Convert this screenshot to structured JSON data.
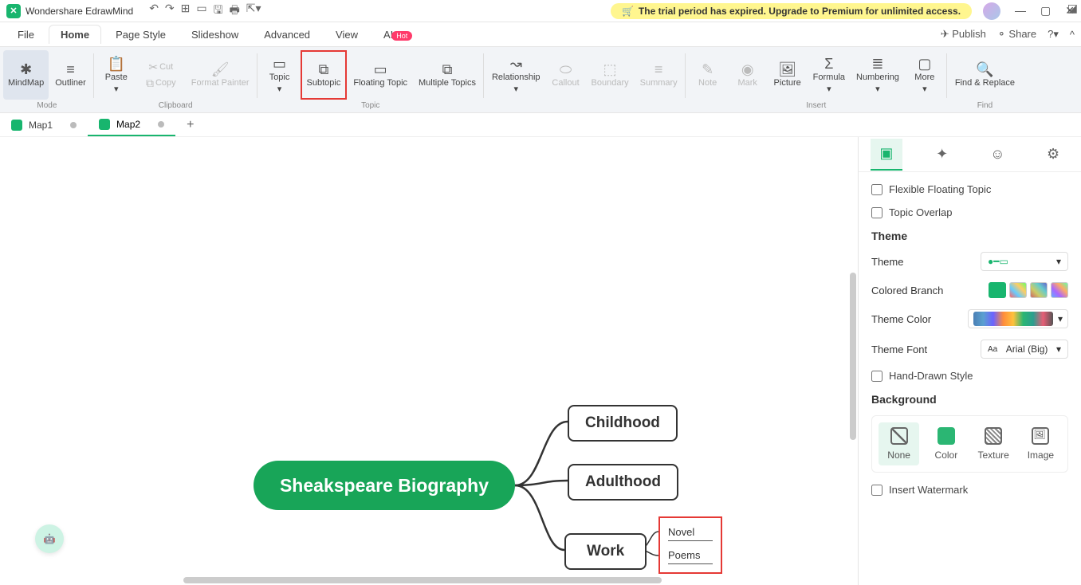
{
  "app": {
    "title": "Wondershare EdrawMind"
  },
  "trial": {
    "text": "The trial period has expired. Upgrade to Premium for unlimited access."
  },
  "menu": {
    "items": [
      "File",
      "Home",
      "Page Style",
      "Slideshow",
      "Advanced",
      "View",
      "AI"
    ],
    "active": 1,
    "ai_badge": "Hot",
    "publish": "Publish",
    "share": "Share"
  },
  "ribbon": {
    "mode": {
      "mindmap": "MindMap",
      "outliner": "Outliner",
      "label": "Mode"
    },
    "clipboard": {
      "paste": "Paste",
      "cut": "Cut",
      "copy": "Copy",
      "format": "Format Painter",
      "label": "Clipboard"
    },
    "topic": {
      "topic": "Topic",
      "subtopic": "Subtopic",
      "floating": "Floating Topic",
      "multiple": "Multiple Topics",
      "label": "Topic"
    },
    "rel": {
      "relationship": "Relationship",
      "callout": "Callout",
      "boundary": "Boundary",
      "summary": "Summary"
    },
    "insert": {
      "note": "Note",
      "mark": "Mark",
      "picture": "Picture",
      "formula": "Formula",
      "numbering": "Numbering",
      "more": "More",
      "label": "Insert"
    },
    "find": {
      "find": "Find & Replace",
      "label": "Find"
    }
  },
  "doctabs": {
    "t1": "Map1",
    "t2": "Map2",
    "active": 1
  },
  "mindmap": {
    "central": "Sheakspeare Biography",
    "nodes": [
      "Childhood",
      "Adulthood",
      "Work"
    ],
    "subs": [
      "Novel",
      "Poems"
    ]
  },
  "panel": {
    "check1": "Flexible Floating Topic",
    "check2": "Topic Overlap",
    "theme_hdr": "Theme",
    "theme_lbl": "Theme",
    "branch_lbl": "Colored Branch",
    "color_lbl": "Theme Color",
    "font_lbl": "Theme Font",
    "font_val": "Arial (Big)",
    "hand_lbl": "Hand-Drawn Style",
    "bg_hdr": "Background",
    "bg_none": "None",
    "bg_color": "Color",
    "bg_tex": "Texture",
    "bg_img": "Image",
    "watermark": "Insert Watermark"
  }
}
